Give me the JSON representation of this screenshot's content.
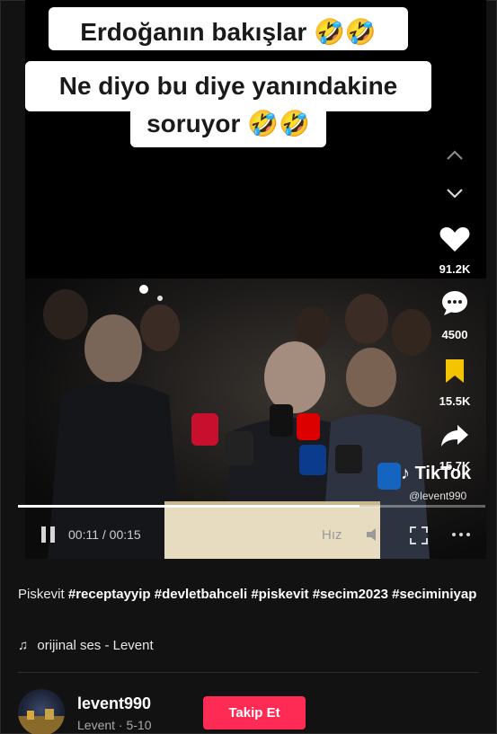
{
  "video": {
    "captions": [
      "Erdoğanın bakışlar 🤣🤣",
      "Ne diyo bu diye yanındakine",
      "soruyor 🤣🤣"
    ],
    "time": "00:11 / 00:15",
    "progress_fraction": 0.73,
    "brand": "TikTok",
    "watermark_user": "@levent990",
    "quality_label": "Hız"
  },
  "actions": {
    "likes": "91.2K",
    "comments": "4500",
    "saves": "15.5K",
    "shares": "15.7K"
  },
  "post": {
    "text": "Piskevit",
    "hashtags": [
      "#receptayyip",
      "#devletbahceli",
      "#piskevit",
      "#secim2023",
      "#seciminiyap"
    ],
    "music": "orijinal ses - Levent"
  },
  "author": {
    "username": "levent990",
    "subline": "Levent · 5-10",
    "follow_label": "Takip Et"
  },
  "colors": {
    "follow_button": "#fe2c55",
    "save_icon": "#f5c400"
  }
}
